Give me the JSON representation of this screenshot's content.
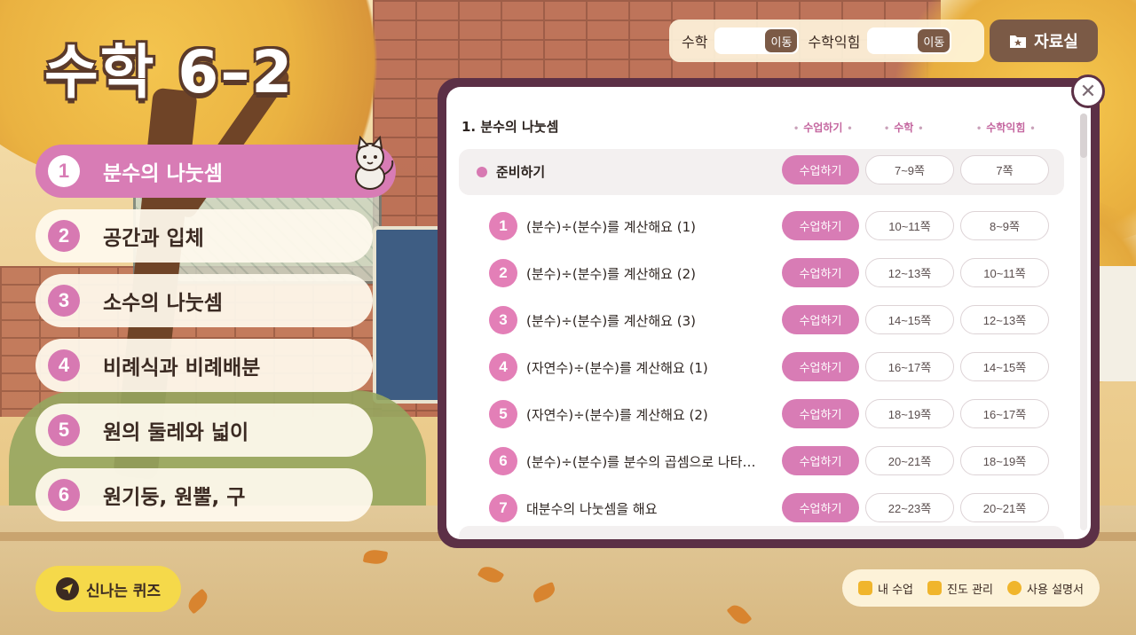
{
  "app": {
    "title": "수학 6–2"
  },
  "topnav": {
    "math_label": "수학",
    "math_go": "이동",
    "workbook_label": "수학익힘",
    "workbook_go": "이동",
    "library_label": "자료실",
    "library_icon": "star-folder-icon"
  },
  "chapters": [
    {
      "num": "1",
      "label": "분수의 나눗셈",
      "active": true
    },
    {
      "num": "2",
      "label": "공간과 입체",
      "active": false
    },
    {
      "num": "3",
      "label": "소수의 나눗셈",
      "active": false
    },
    {
      "num": "4",
      "label": "비례식과 비례배분",
      "active": false
    },
    {
      "num": "5",
      "label": "원의 둘레와 넓이",
      "active": false
    },
    {
      "num": "6",
      "label": "원기둥, 원뿔, 구",
      "active": false
    }
  ],
  "panel": {
    "heading": "1. 분수의 나눗셈",
    "columns": [
      "수업하기",
      "수학",
      "수학익힘"
    ],
    "prep": {
      "label": "준비하기",
      "class_btn": "수업하기",
      "math": "7~9쪽",
      "workbook": "7쪽"
    },
    "lessons": [
      {
        "num": "1",
        "title": "(분수)÷(분수)를 계산해요 (1)",
        "class_btn": "수업하기",
        "math": "10~11쪽",
        "workbook": "8~9쪽"
      },
      {
        "num": "2",
        "title": "(분수)÷(분수)를 계산해요 (2)",
        "class_btn": "수업하기",
        "math": "12~13쪽",
        "workbook": "10~11쪽"
      },
      {
        "num": "3",
        "title": "(분수)÷(분수)를 계산해요 (3)",
        "class_btn": "수업하기",
        "math": "14~15쪽",
        "workbook": "12~13쪽"
      },
      {
        "num": "4",
        "title": "(자연수)÷(분수)를 계산해요 (1)",
        "class_btn": "수업하기",
        "math": "16~17쪽",
        "workbook": "14~15쪽"
      },
      {
        "num": "5",
        "title": "(자연수)÷(분수)를 계산해요 (2)",
        "class_btn": "수업하기",
        "math": "18~19쪽",
        "workbook": "16~17쪽"
      },
      {
        "num": "6",
        "title": "(분수)÷(분수)를 분수의 곱셈으로 나타…",
        "class_btn": "수업하기",
        "math": "20~21쪽",
        "workbook": "18~19쪽"
      },
      {
        "num": "7",
        "title": "대분수의 나눗셈을 해요",
        "class_btn": "수업하기",
        "math": "22~23쪽",
        "workbook": "20~21쪽"
      }
    ],
    "close_icon": "close-icon"
  },
  "quiz": {
    "label": "신나는 퀴즈",
    "icon": "paper-plane-icon"
  },
  "bottomnav": {
    "my_class": "내 수업",
    "progress": "진도 관리",
    "manual": "사용 설명서"
  },
  "colors": {
    "accent_pink": "#d87cb5",
    "panel_border": "#5c3046",
    "brown": "#7b5a46",
    "quiz_yellow": "#f5d94a"
  }
}
